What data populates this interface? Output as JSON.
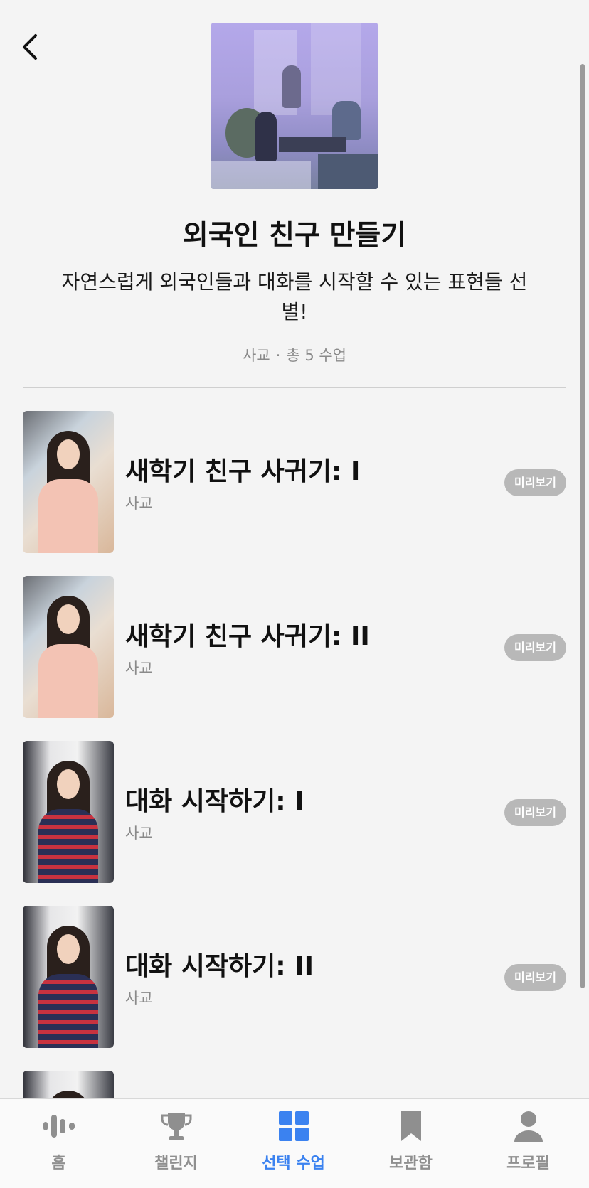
{
  "header": {
    "back_icon": "chevron-left-icon"
  },
  "course": {
    "title": "외국인 친구 만들기",
    "description": "자연스럽게 외국인들과 대화를 시작할 수 있는 표현들 선별!",
    "category": "사교",
    "separator": "·",
    "lesson_count": "총 5 수업"
  },
  "lessons": [
    {
      "title": "새학기 친구 사귀기: I",
      "category": "사교",
      "preview_label": "미리보기"
    },
    {
      "title": "새학기 친구 사귀기: II",
      "category": "사교",
      "preview_label": "미리보기"
    },
    {
      "title": "대화 시작하기: I",
      "category": "사교",
      "preview_label": "미리보기"
    },
    {
      "title": "대화 시작하기: II",
      "category": "사교",
      "preview_label": "미리보기"
    }
  ],
  "tabbar": {
    "items": [
      {
        "label": "홈",
        "icon": "audio-wave-icon"
      },
      {
        "label": "챌린지",
        "icon": "trophy-icon"
      },
      {
        "label": "선택 수업",
        "icon": "grid-icon",
        "active": true
      },
      {
        "label": "보관함",
        "icon": "bookmark-icon"
      },
      {
        "label": "프로필",
        "icon": "person-icon"
      }
    ]
  },
  "colors": {
    "accent": "#3b82f0",
    "background": "#f4f4f4",
    "inactive": "#8f8f8f",
    "preview_button": "#b8b8b8"
  }
}
